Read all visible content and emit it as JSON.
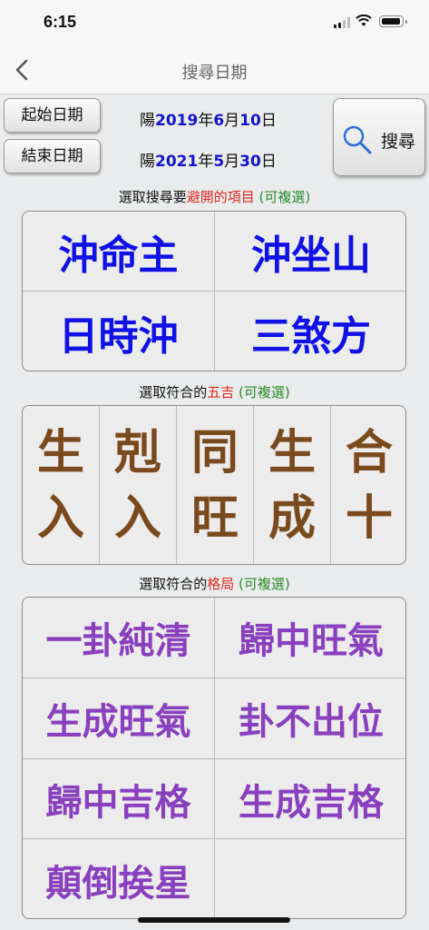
{
  "status_bar": {
    "time": "6:15"
  },
  "nav": {
    "title": "搜尋日期"
  },
  "dates": {
    "start_button": "起始日期",
    "end_button": "結束日期",
    "start": {
      "prefix": "陽",
      "year": "2019",
      "y": "年",
      "month": "6",
      "m": "月",
      "day": "10",
      "d": "日"
    },
    "end": {
      "prefix": "陽",
      "year": "2021",
      "y": "年",
      "month": "5",
      "m": "月",
      "day": "30",
      "d": "日"
    },
    "search_label": "搜尋"
  },
  "avoid": {
    "title_pre": "選取搜尋要",
    "title_hl": "避開的項目",
    "title_post": "(可複選)",
    "items": [
      "沖命主",
      "沖坐山",
      "日時沖",
      "三煞方"
    ]
  },
  "wuji": {
    "title_pre": "選取符合的",
    "title_hl": "五吉",
    "title_post": "(可複選)",
    "items": [
      {
        "top": "生",
        "bottom": "入"
      },
      {
        "top": "剋",
        "bottom": "入"
      },
      {
        "top": "同",
        "bottom": "旺"
      },
      {
        "top": "生",
        "bottom": "成"
      },
      {
        "top": "合",
        "bottom": "十"
      }
    ]
  },
  "geju": {
    "title_pre": "選取符合的",
    "title_hl": "格局",
    "title_post": "(可複選)",
    "items": [
      "一卦純清",
      "歸中旺氣",
      "生成旺氣",
      "卦不出位",
      "歸中吉格",
      "生成吉格",
      "顛倒挨星"
    ]
  },
  "colors": {
    "avoid_text": "#1010e8",
    "wuji_text": "#7a4a1c",
    "geju_text": "#8a3fbf",
    "date_highlight": "#1515cc",
    "title_highlight": "#e0281e",
    "multi_select": "#2a8a2a"
  }
}
